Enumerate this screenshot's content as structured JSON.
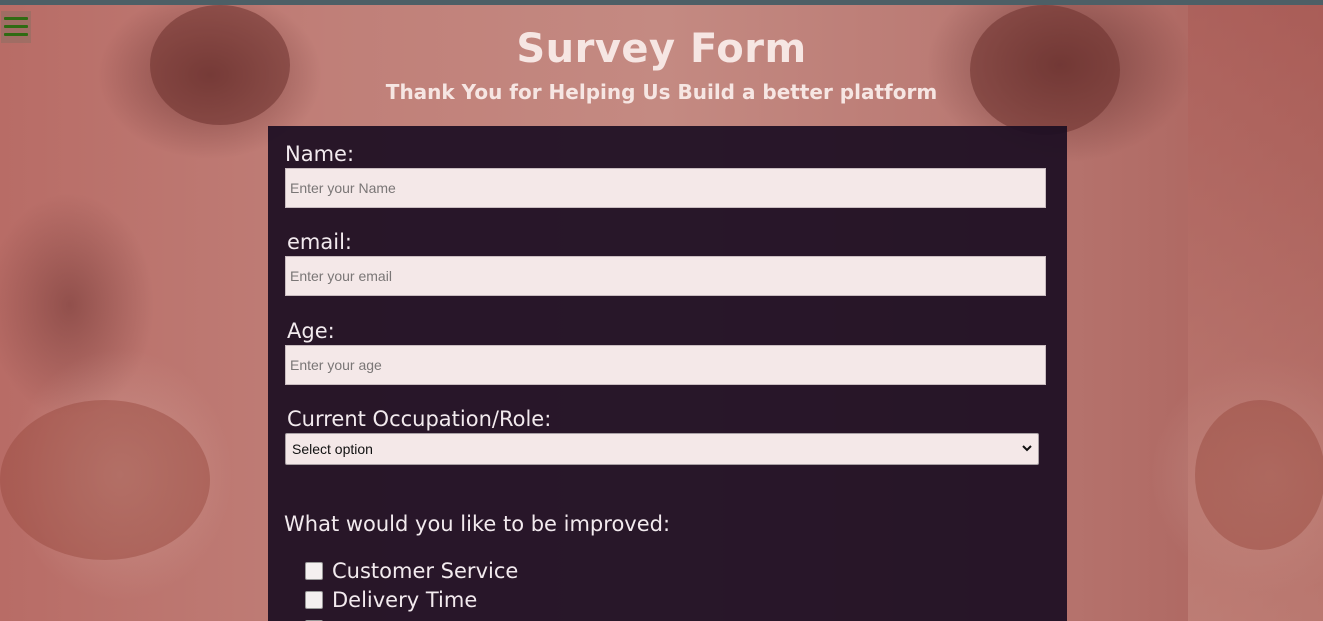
{
  "header": {
    "title": "Survey Form",
    "subtitle": "Thank You for Helping Us Build a better platform"
  },
  "menu": {
    "icon": "hamburger-menu-icon",
    "color": "#2f6b12"
  },
  "form": {
    "name": {
      "label": "Name:",
      "placeholder": "Enter your Name"
    },
    "email": {
      "label": "email:",
      "placeholder": "Enter your email"
    },
    "age": {
      "label": "Age:",
      "placeholder": "Enter your age"
    },
    "occupation": {
      "label": "Current Occupation/Role:",
      "selected": "Select option"
    },
    "improvements": {
      "label": "What would you like to be improved:",
      "options": [
        {
          "label": "Customer Service",
          "checked": false
        },
        {
          "label": "Delivery Time",
          "checked": false
        }
      ]
    }
  },
  "colors": {
    "panel": "#1c0e22",
    "text": "#f2eaee",
    "input_bg": "#f4e8e8",
    "background": "#b9706a"
  }
}
